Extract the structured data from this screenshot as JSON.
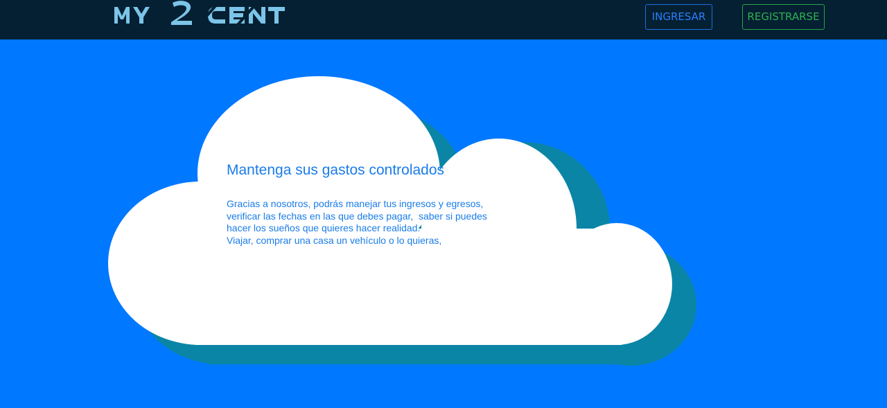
{
  "brand": {
    "logo_text": "MY 2 CENT",
    "colors": {
      "logo": "#7cc4e8",
      "topbar": "#042032"
    }
  },
  "nav": {
    "login_label": "INGRESAR",
    "register_label": "REGISTRARSE"
  },
  "hero": {
    "title": "Mantenga sus gastos controlados",
    "lines": [
      "Gracias a nosotros, podrás manejar tus ingresos y egresos,",
      "verificar las fechas en las que debes pagar,  saber si puedes",
      "hacer los sueños que quieres hacer realidad.",
      "Viajar, comprar una casa un vehículo o lo quieras,"
    ]
  },
  "colors": {
    "background": "#0078ff",
    "cloud": "#ffffff",
    "cloud_shadow": "#0b85a6",
    "text": "#1a7ce8"
  }
}
